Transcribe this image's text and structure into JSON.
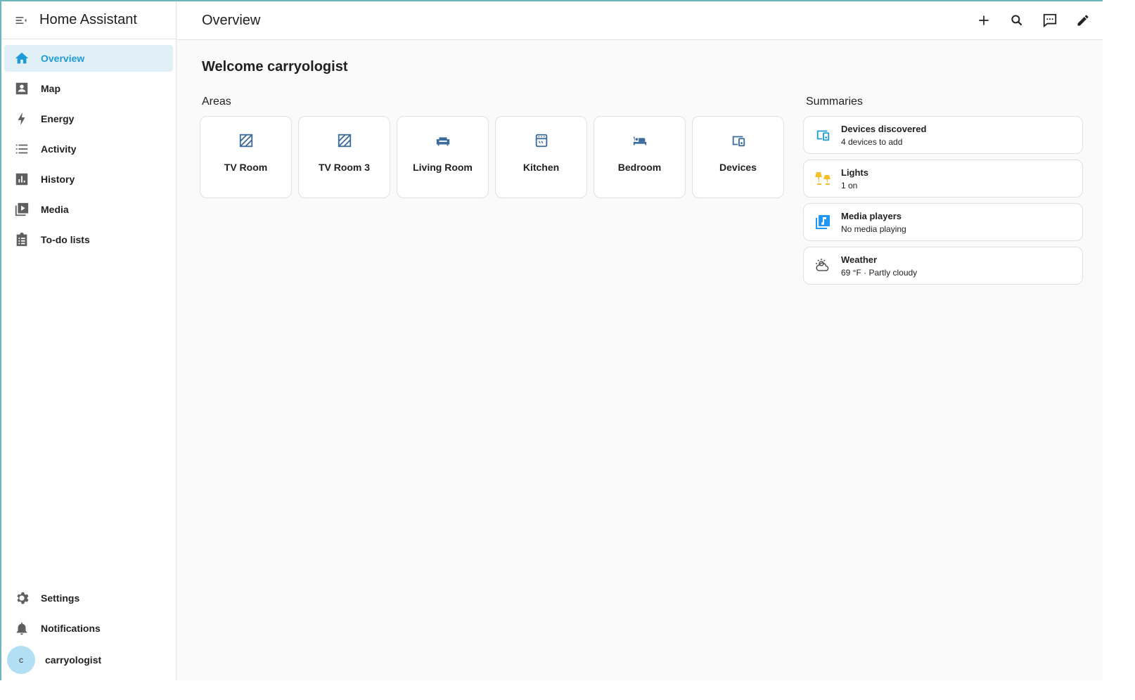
{
  "app": {
    "title": "Home Assistant"
  },
  "sidebar": {
    "items": [
      {
        "label": "Overview",
        "icon": "home-icon"
      },
      {
        "label": "Map",
        "icon": "map-person-icon"
      },
      {
        "label": "Energy",
        "icon": "lightning-icon"
      },
      {
        "label": "Activity",
        "icon": "list-icon"
      },
      {
        "label": "History",
        "icon": "chart-bar-icon"
      },
      {
        "label": "Media",
        "icon": "play-box-icon"
      },
      {
        "label": "To-do lists",
        "icon": "clipboard-list-icon"
      }
    ],
    "bottom": [
      {
        "label": "Settings",
        "icon": "gear-icon"
      },
      {
        "label": "Notifications",
        "icon": "bell-icon"
      }
    ],
    "user": {
      "initial": "c",
      "name": "carryologist"
    }
  },
  "header": {
    "title": "Overview"
  },
  "main": {
    "welcome": "Welcome carryologist",
    "areas_title": "Areas",
    "areas": [
      {
        "name": "TV Room",
        "icon": "texture-box-icon"
      },
      {
        "name": "TV Room 3",
        "icon": "texture-box-icon"
      },
      {
        "name": "Living Room",
        "icon": "sofa-icon"
      },
      {
        "name": "Kitchen",
        "icon": "stove-icon"
      },
      {
        "name": "Bedroom",
        "icon": "bed-icon"
      },
      {
        "name": "Devices",
        "icon": "devices-icon"
      }
    ],
    "summaries_title": "Summaries",
    "summaries": [
      {
        "name": "Devices discovered",
        "sub": "4 devices to add",
        "icon": "devices-icon",
        "color": "#1d9bd7"
      },
      {
        "name": "Lights",
        "sub": "1 on",
        "icon": "lamps-icon",
        "color": "#f6bf2b"
      },
      {
        "name": "Media players",
        "sub": "No media playing",
        "icon": "music-box-icon",
        "color": "#2196f3"
      },
      {
        "name": "Weather",
        "sub": "69 °F · Partly cloudy",
        "icon": "weather-partly-cloudy-icon",
        "color": "#555555"
      }
    ]
  },
  "colors": {
    "accent": "#03a9f4",
    "active_bg": "#e1f0f7",
    "area_icon": "#3b6c9b"
  }
}
